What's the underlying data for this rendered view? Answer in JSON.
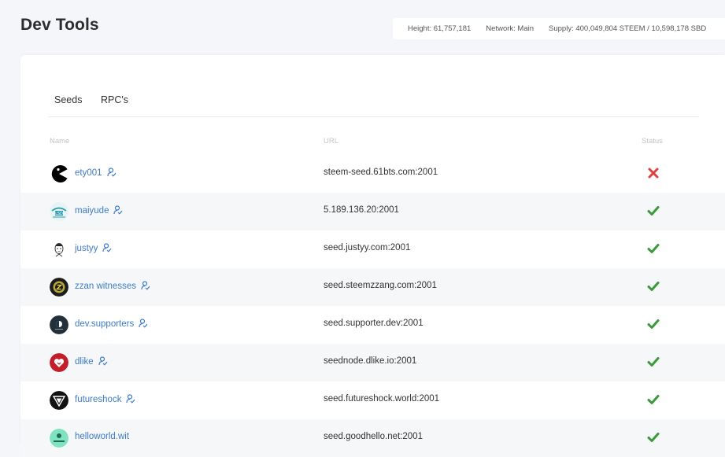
{
  "header": {
    "title": "Dev Tools"
  },
  "stats": {
    "height": "Height: 61,757,181",
    "network": "Network: Main",
    "supply": "Supply: 400,049,804 STEEM / 10,598,178 SBD"
  },
  "tabs": [
    {
      "label": "Seeds"
    },
    {
      "label": "RPC's"
    }
  ],
  "table": {
    "columns": {
      "name": "Name",
      "url": "URL",
      "status": "Status"
    },
    "rows": [
      {
        "name": "ety001",
        "url": "steem-seed.61bts.com:2001",
        "status": "offline",
        "avatar": "pacman-avatar"
      },
      {
        "name": "maiyude",
        "url": "5.189.136.20:2001",
        "status": "online",
        "avatar": "maiyude-avatar"
      },
      {
        "name": "justyy",
        "url": "seed.justyy.com:2001",
        "status": "online",
        "avatar": "justyy-avatar"
      },
      {
        "name": "zzan witnesses",
        "url": "seed.steemzzang.com:2001",
        "status": "online",
        "avatar": "zzan-avatar"
      },
      {
        "name": "dev.supporters",
        "url": "seed.supporter.dev:2001",
        "status": "online",
        "avatar": "dev-supporters-avatar"
      },
      {
        "name": "dlike",
        "url": "seednode.dlike.io:2001",
        "status": "online",
        "avatar": "dlike-avatar"
      },
      {
        "name": "futureshock",
        "url": "seed.futureshock.world:2001",
        "status": "online",
        "avatar": "futureshock-avatar"
      },
      {
        "name": "helloworld.wit",
        "url": "seed.goodhello.net:2001",
        "status": "online",
        "avatar": "helloworld-avatar"
      }
    ]
  },
  "colors": {
    "link": "#3d7bc9",
    "online": "#3a9a3a",
    "offline": "#e04040"
  }
}
